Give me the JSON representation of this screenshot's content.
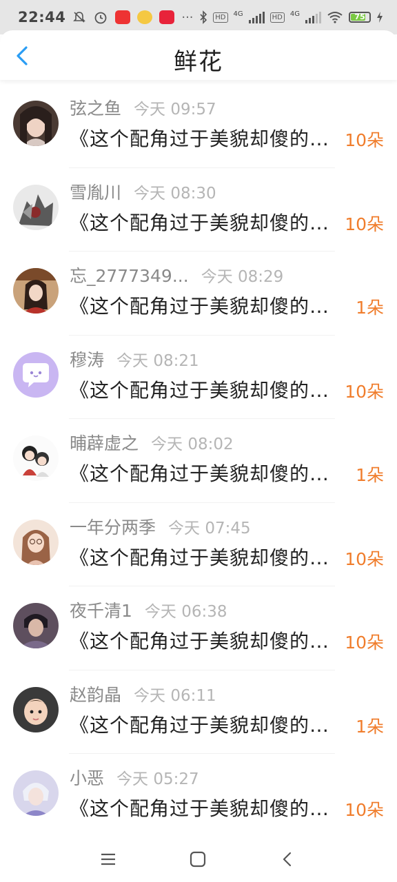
{
  "status_bar": {
    "time": "22:44",
    "network_1": "4G",
    "network_2": "4G",
    "hd_1": "HD",
    "hd_2": "HD",
    "battery": "75"
  },
  "header": {
    "title": "鲜花",
    "back_icon": "chevron-left-icon"
  },
  "colors": {
    "accent_blue": "#2a9df4",
    "count_orange": "#f07d2c",
    "name_gray": "#8a8a8a",
    "time_gray": "#b5b5b5"
  },
  "items": [
    {
      "name": "弦之鱼",
      "time": "今天 09:57",
      "message": "《这个配角过于美貌却傻的白月光",
      "count": "10朵",
      "avatar": "avatar-girl-dark-hair"
    },
    {
      "name": "雪胤川",
      "time": "今天 08:30",
      "message": "《这个配角过于美貌却傻的白月光",
      "count": "10朵",
      "avatar": "avatar-armored-figure"
    },
    {
      "name": "忘_2777349...",
      "time": "今天 08:29",
      "message": "《这个配角过于美貌却傻的白月光",
      "count": "1朵",
      "avatar": "avatar-ancient-style-girl"
    },
    {
      "name": "穆涛",
      "time": "今天 08:21",
      "message": "《这个配角过于美貌却傻的白月光",
      "count": "10朵",
      "avatar": "avatar-default-chat-bubble"
    },
    {
      "name": "晡薜虚之",
      "time": "今天 08:02",
      "message": "《这个配角过于美貌却傻的白月光",
      "count": "1朵",
      "avatar": "avatar-chibi-characters"
    },
    {
      "name": "一年分两季",
      "time": "今天 07:45",
      "message": "《这个配角过于美貌却傻的白月光",
      "count": "10朵",
      "avatar": "avatar-girl-glasses"
    },
    {
      "name": "夜千清1",
      "time": "今天 06:38",
      "message": "《这个配角过于美貌却傻的白月光",
      "count": "10朵",
      "avatar": "avatar-boy-portrait"
    },
    {
      "name": "赵韵晶",
      "time": "今天 06:11",
      "message": "《这个配角过于美貌却傻的白月光",
      "count": "1朵",
      "avatar": "avatar-baby"
    },
    {
      "name": "小恶",
      "time": "今天 05:27",
      "message": "《这个配角过于美貌却傻的白月光",
      "count": "10朵",
      "avatar": "avatar-light-hair-boy"
    }
  ],
  "nav_bar": {
    "menu_icon": "menu-icon",
    "home_icon": "home-icon",
    "back_icon": "back-icon"
  }
}
